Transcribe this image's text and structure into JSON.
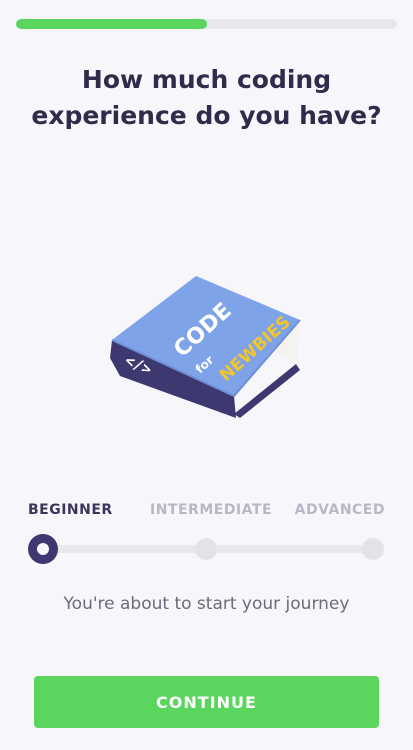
{
  "progress": {
    "value": 0.5,
    "fill_color": "#5ad65e"
  },
  "question": {
    "title": "How much coding\nexperience do you have?"
  },
  "illustration": {
    "name": "code-for-newbies-book",
    "cover_word": "CODE",
    "cover_small": "for",
    "cover_accent": "NEWBIES",
    "spine_glyph": "</>"
  },
  "experience": {
    "levels": [
      "BEGINNER",
      "INTERMEDIATE",
      "ADVANCED"
    ],
    "selected": "BEGINNER",
    "selected_index": 0,
    "caption": "You're about to start your journey"
  },
  "continue_button": {
    "label": "CONTINUE"
  },
  "colors": {
    "accent": "#5ad65e",
    "primary_text": "#2f2b4b",
    "muted_text": "#b8b8c4",
    "thumb": "#3e3870",
    "book_cover": "#7fa3e8",
    "book_spine": "#3e3870",
    "newbies_text": "#f2c62b"
  }
}
